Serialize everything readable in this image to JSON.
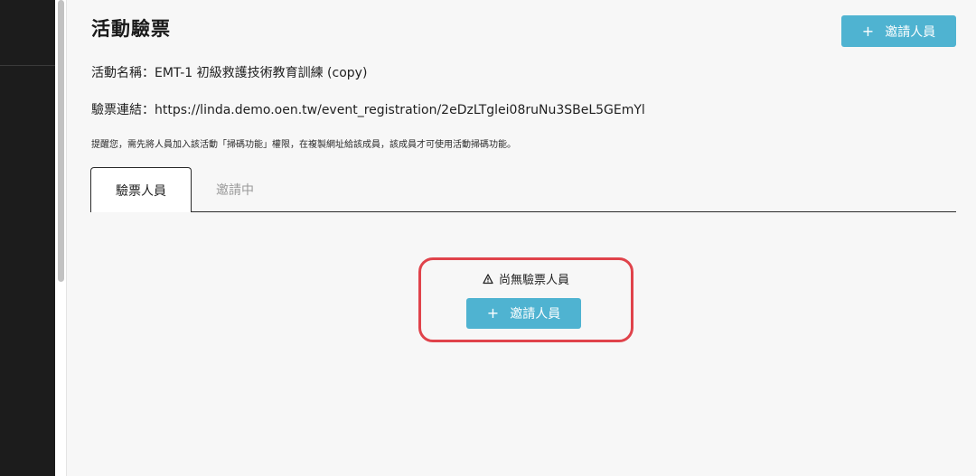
{
  "page": {
    "title": "活動驗票",
    "event_name": "活動名稱：EMT-1 初級救護技術教育訓練 (copy)",
    "ticket_link": "驗票連結：https://linda.demo.oen.tw/event_registration/2eDzLTglei08ruNu3SBeL5GEmYl",
    "reminder": "提醒您，需先將人員加入該活動「掃碼功能」權限，在複製網址給該成員，該成員才可使用活動掃碼功能。"
  },
  "header": {
    "invite_button": {
      "icon": "plus-icon",
      "plus": "+",
      "label": "邀請人員"
    }
  },
  "tabs": [
    {
      "label": "驗票人員",
      "active": true
    },
    {
      "label": "邀請中",
      "active": false
    }
  ],
  "empty_state": {
    "icon": "warning-icon",
    "message": "尚無驗票人員",
    "invite_button": {
      "icon": "plus-icon",
      "plus": "+",
      "label": "邀請人員"
    }
  },
  "colors": {
    "primary_button": "#4fb3d1",
    "highlight_border": "#e0434b",
    "sidebar": "#1c1c1c"
  }
}
